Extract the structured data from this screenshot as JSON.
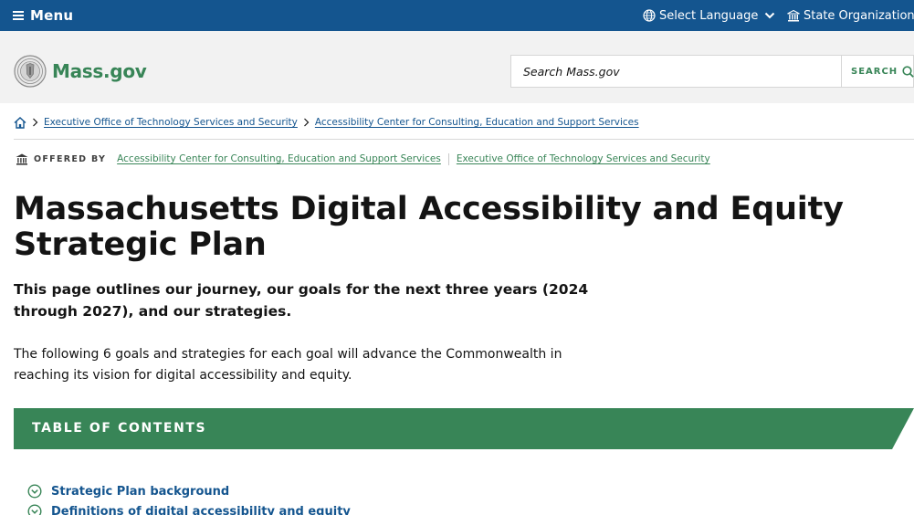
{
  "topbar": {
    "menu_label": "Menu",
    "language_label": "Select Language",
    "orgs_label": "State Organizations"
  },
  "header": {
    "logo_text": "Mass.gov",
    "search_placeholder": "Search Mass.gov",
    "search_button_label": "SEARCH"
  },
  "breadcrumb": {
    "items": [
      "Executive Office of Technology Services and Security",
      "Accessibility Center for Consulting, Education and Support Services"
    ]
  },
  "offered_by": {
    "label": "OFFERED BY",
    "orgs": [
      "Accessibility Center for Consulting, Education and Support Services",
      "Executive Office of Technology Services and Security"
    ]
  },
  "page": {
    "title": "Massachusetts Digital Accessibility and Equity Strategic Plan",
    "lede": "This page outlines our journey, our goals for the next three years (2024 through 2027), and our strategies.",
    "body": "The following 6 goals and strategies for each goal will advance the Commonwealth in reaching its vision for digital accessibility and equity."
  },
  "toc": {
    "heading": "TABLE OF CONTENTS",
    "items": [
      "Strategic Plan background",
      "Definitions of digital accessibility and equity"
    ]
  },
  "colors": {
    "topbar_blue": "#14558f",
    "brand_green": "#388557",
    "header_gray": "#f2f2f2"
  }
}
